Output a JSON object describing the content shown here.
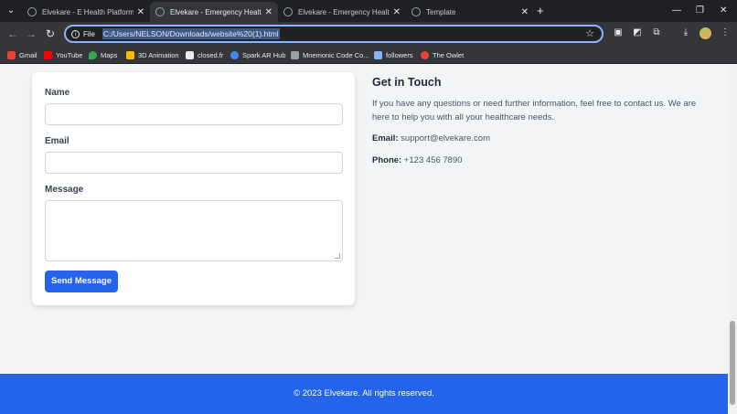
{
  "browser": {
    "tabs": [
      {
        "title": "Elvekare - E Health Platform fo"
      },
      {
        "title": "Elvekare - Emergency Healthcare"
      },
      {
        "title": "Elvekare - Emergency Healthcare"
      },
      {
        "title": "Template"
      }
    ],
    "address": {
      "chip": "File",
      "url": "C:/Users/NELSON/Downloads/website%20(1).html"
    },
    "bookmarks": [
      {
        "label": "Gmail",
        "color": "#ea4335"
      },
      {
        "label": "YouTube",
        "color": "#ff0000"
      },
      {
        "label": "Maps",
        "color": "#34a853"
      },
      {
        "label": "3D Animation",
        "color": "#fbbc04"
      },
      {
        "label": "closed.fr",
        "color": "#e8eaed"
      },
      {
        "label": "Spark AR Hub",
        "color": "#4285f4"
      },
      {
        "label": "Mnemonic Code Co...",
        "color": "#9aa0a6"
      },
      {
        "label": "followers",
        "color": "#8ab4f8"
      },
      {
        "label": "The Owlet",
        "color": "#ea4335"
      }
    ]
  },
  "form": {
    "name_label": "Name",
    "email_label": "Email",
    "message_label": "Message",
    "send_label": "Send Message"
  },
  "contact": {
    "title": "Get in Touch",
    "description": "If you have any questions or need further information, feel free to contact us. We are here to help you with all your healthcare needs.",
    "email_label": "Email:",
    "email_value": "support@elvekare.com",
    "phone_label": "Phone:",
    "phone_value": "+123 456 7890"
  },
  "footer": {
    "text": "© 2023 Elvekare. All rights reserved."
  },
  "colors": {
    "accent": "#2563eb"
  }
}
